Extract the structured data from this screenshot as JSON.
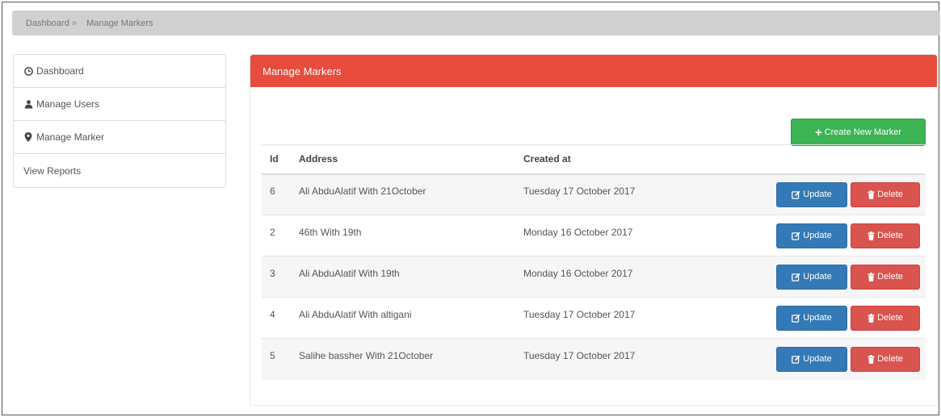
{
  "breadcrumb": {
    "items": [
      "Dashboard",
      "Manage Markers"
    ],
    "separator": "»"
  },
  "sidebar": {
    "items": [
      {
        "label": "Dashboard",
        "icon": "clock-icon"
      },
      {
        "label": "Manage Users",
        "icon": "user-icon"
      },
      {
        "label": "Manage Marker",
        "icon": "map-marker-icon"
      },
      {
        "label": "View Reports",
        "icon": ""
      }
    ]
  },
  "panel": {
    "title": "Manage Markers",
    "create_label": "Create New Marker"
  },
  "table": {
    "headers": {
      "id": "Id",
      "address": "Address",
      "created": "Created at"
    },
    "rows": [
      {
        "id": "6",
        "address": "Ali AbduAlatif With 21October",
        "created": "Tuesday 17 October 2017"
      },
      {
        "id": "2",
        "address": "46th With 19th",
        "created": "Monday 16 October 2017"
      },
      {
        "id": "3",
        "address": "Ali AbduAlatif With 19th",
        "created": "Monday 16 October 2017"
      },
      {
        "id": "4",
        "address": "Ali AbduAlatif With altigani",
        "created": "Tuesday 17 October 2017"
      },
      {
        "id": "5",
        "address": "Salihe bassher With 21October",
        "created": "Tuesday 17 October 2017"
      }
    ],
    "update_label": "Update",
    "delete_label": "Delete"
  },
  "colors": {
    "header_red": "#e74c3c",
    "create_green": "#3cb454",
    "update_blue": "#337ab7",
    "delete_red": "#d9534f",
    "breadcrumb_bg": "#d0d0d0"
  }
}
